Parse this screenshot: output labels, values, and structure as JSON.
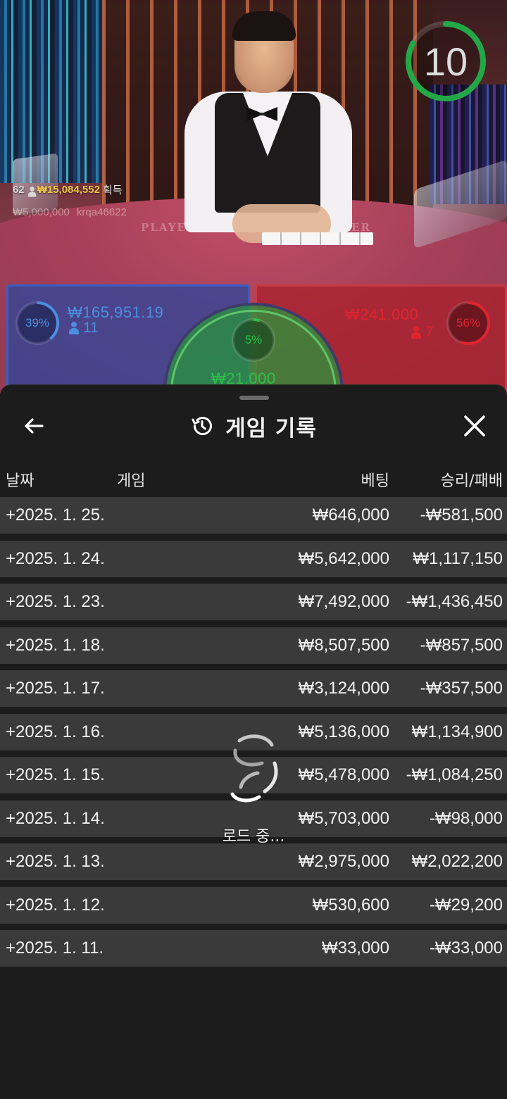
{
  "stream": {
    "timer": {
      "value": "10",
      "progress": 0.83,
      "color": "#22a847"
    },
    "ticker": {
      "winners_count": "62",
      "won_amount": "₩15,084,552",
      "won_label": "획득",
      "bet_amount": "₩5,000,000",
      "username": "krqa46622"
    },
    "felt_labels": {
      "player": "PLAYER",
      "banker": "BANKER"
    },
    "player": {
      "percent": "39%",
      "percent_value": 0.39,
      "stake": "₩165,951.19",
      "players": "11",
      "color": "#4a8ee0"
    },
    "banker": {
      "percent": "56%",
      "percent_value": 0.56,
      "stake": "₩241,000",
      "players": "7",
      "color": "#e0242e"
    },
    "tie": {
      "percent": "5%",
      "percent_value": 0.05,
      "stake": "₩21,000",
      "color": "#2fbf4a"
    }
  },
  "sheet": {
    "title": "게임 기록",
    "columns": {
      "date": "날짜",
      "game": "게임",
      "bet": "베팅",
      "result": "승리/패배"
    },
    "rows": [
      {
        "date": "+2025. 1. 25.",
        "bet": "₩646,000",
        "result": "-₩581,500"
      },
      {
        "date": "+2025. 1. 24.",
        "bet": "₩5,642,000",
        "result": "₩1,117,150"
      },
      {
        "date": "+2025. 1. 23.",
        "bet": "₩7,492,000",
        "result": "-₩1,436,450"
      },
      {
        "date": "+2025. 1. 18.",
        "bet": "₩8,507,500",
        "result": "-₩857,500"
      },
      {
        "date": "+2025. 1. 17.",
        "bet": "₩3,124,000",
        "result": "-₩357,500"
      },
      {
        "date": "+2025. 1. 16.",
        "bet": "₩5,136,000",
        "result": "₩1,134,900"
      },
      {
        "date": "+2025. 1. 15.",
        "bet": "₩5,478,000",
        "result": "-₩1,084,250"
      },
      {
        "date": "+2025. 1. 14.",
        "bet": "₩5,703,000",
        "result": "-₩98,000"
      },
      {
        "date": "+2025. 1. 13.",
        "bet": "₩2,975,000",
        "result": "₩2,022,200"
      },
      {
        "date": "+2025. 1. 12.",
        "bet": "₩530,600",
        "result": "-₩29,200"
      },
      {
        "date": "+2025. 1. 11.",
        "bet": "₩33,000",
        "result": "-₩33,000"
      }
    ],
    "loading_text": "로드 중..."
  },
  "icons": {
    "back": "arrow-left-icon",
    "history": "history-clock-icon",
    "close": "close-icon",
    "loading": "loading-spinner-icon",
    "person": "person-icon"
  }
}
